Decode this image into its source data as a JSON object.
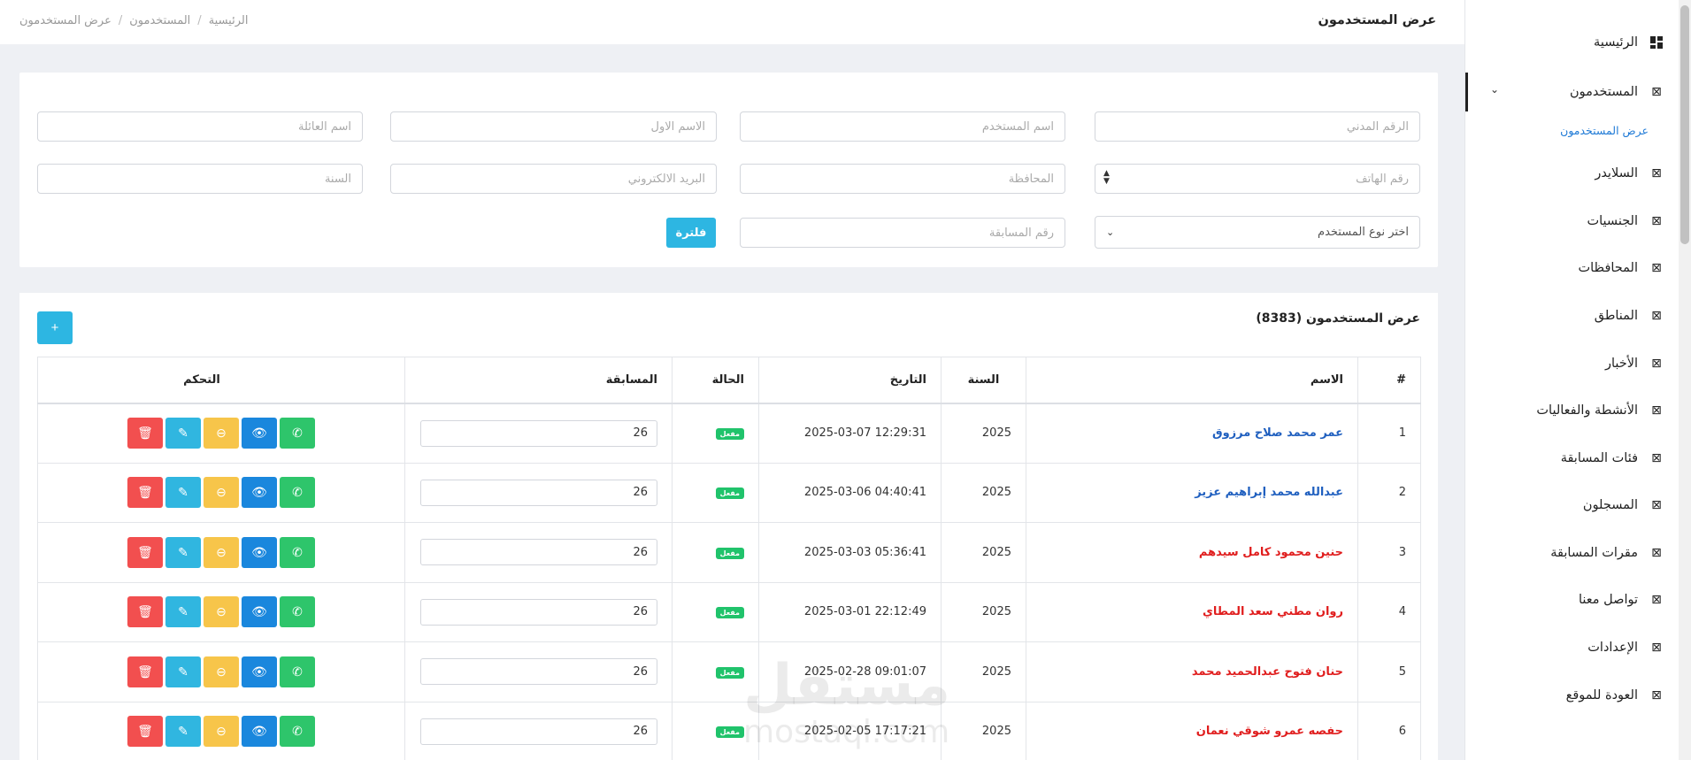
{
  "breadcrumb": [
    "الرئيسية",
    "المستخدمون",
    "عرض المستخدمون"
  ],
  "page_title": "عرض المستخدمون",
  "sidebar": {
    "items": [
      {
        "label": "الرئيسية",
        "icon": "dashboard-icon"
      },
      {
        "label": "المستخدمون",
        "icon": "grid-icon"
      },
      {
        "label": "السلايدر",
        "icon": "grid-icon"
      },
      {
        "label": "الجنسيات",
        "icon": "grid-icon"
      },
      {
        "label": "المحافظات",
        "icon": "grid-icon"
      },
      {
        "label": "المناطق",
        "icon": "grid-icon"
      },
      {
        "label": "الأخبار",
        "icon": "grid-icon"
      },
      {
        "label": "الأنشطة والفعاليات",
        "icon": "grid-icon"
      },
      {
        "label": "فئات المسابقة",
        "icon": "grid-icon"
      },
      {
        "label": "المسجلون",
        "icon": "grid-icon"
      },
      {
        "label": "مقرات المسابقة",
        "icon": "grid-icon"
      },
      {
        "label": "تواصل معنا",
        "icon": "grid-icon"
      },
      {
        "label": "الإعدادات",
        "icon": "grid-icon"
      },
      {
        "label": "العودة للموقع",
        "icon": "grid-icon"
      }
    ],
    "sub_item": "عرض المستخدمون"
  },
  "filters": {
    "civil_id": "الرقم المدني",
    "username": "اسم المستخدم",
    "first_name": "الاسم الاول",
    "family_name": "اسم العائلة",
    "phone": "رقم الهاتف",
    "governorate": "المحافظة",
    "email": "البريد الالكتروني",
    "year": "السنة",
    "user_type": "اختر نوع المستخدم",
    "competition_no": "رقم المسابقة",
    "filter_button": "فلترة"
  },
  "list": {
    "title": "عرض المستخدمون (8383)",
    "add_button": "+",
    "headers": {
      "num": "#",
      "name": "الاسم",
      "year": "السنة",
      "date": "التاريخ",
      "status": "الحالة",
      "competition": "المسابقة",
      "control": "التحكم"
    },
    "rows": [
      {
        "num": "1",
        "name": "عمر محمد صلاح مرزوق",
        "name_color": "blue",
        "year": "2025",
        "date": "2025-03-07 12:29:31",
        "status": "مفعل",
        "competition": "26"
      },
      {
        "num": "2",
        "name": "عبدالله محمد إبراهيم عزيز",
        "name_color": "blue",
        "year": "2025",
        "date": "2025-03-06 04:40:41",
        "status": "مفعل",
        "competition": "26"
      },
      {
        "num": "3",
        "name": "حنين محمود كامل سيدهم",
        "name_color": "red",
        "year": "2025",
        "date": "2025-03-03 05:36:41",
        "status": "مفعل",
        "competition": "26"
      },
      {
        "num": "4",
        "name": "روان مطني سعد المطاي",
        "name_color": "red",
        "year": "2025",
        "date": "2025-03-01 22:12:49",
        "status": "مفعل",
        "competition": "26"
      },
      {
        "num": "5",
        "name": "حنان فتوح عبدالحميد محمد",
        "name_color": "red",
        "year": "2025",
        "date": "2025-02-28 09:01:07",
        "status": "مفعل",
        "competition": "26"
      },
      {
        "num": "6",
        "name": "حفصه عمرو شوقي نعمان",
        "name_color": "red",
        "year": "2025",
        "date": "2025-02-05 17:17:21",
        "status": "مفعل",
        "competition": "26"
      }
    ]
  },
  "watermark": {
    "arabic": "مستقل",
    "latin": "mostaql.com"
  }
}
